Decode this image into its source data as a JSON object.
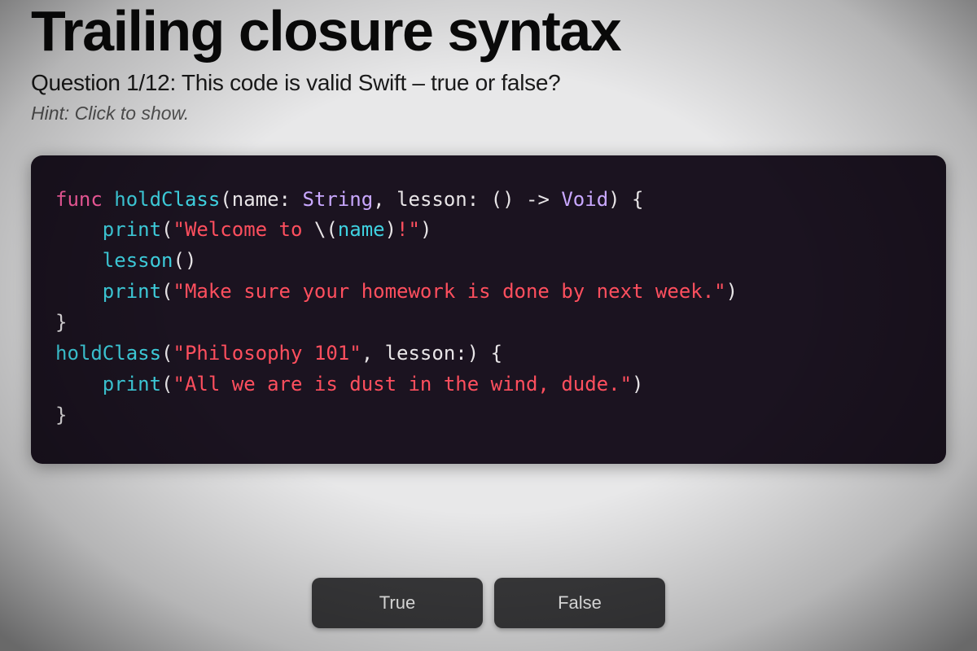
{
  "header": {
    "title": "Trailing closure syntax",
    "question_prefix": "Question 1/12: ",
    "question_body": "This code is valid Swift – true or false?",
    "hint": "Hint: Click to show."
  },
  "code": {
    "tokens": [
      [
        {
          "t": "func ",
          "c": "kw"
        },
        {
          "t": "holdClass",
          "c": "def"
        },
        {
          "t": "(",
          "c": "plain"
        },
        {
          "t": "name",
          "c": "plain"
        },
        {
          "t": ": ",
          "c": "plain"
        },
        {
          "t": "String",
          "c": "type"
        },
        {
          "t": ", ",
          "c": "plain"
        },
        {
          "t": "lesson",
          "c": "plain"
        },
        {
          "t": ": () -> ",
          "c": "plain"
        },
        {
          "t": "Void",
          "c": "type"
        },
        {
          "t": ") {",
          "c": "plain"
        }
      ],
      [
        {
          "t": "    ",
          "c": "plain"
        },
        {
          "t": "print",
          "c": "def"
        },
        {
          "t": "(",
          "c": "plain"
        },
        {
          "t": "\"Welcome to ",
          "c": "str"
        },
        {
          "t": "\\(",
          "c": "plain"
        },
        {
          "t": "name",
          "c": "def"
        },
        {
          "t": ")",
          "c": "plain"
        },
        {
          "t": "!\"",
          "c": "str"
        },
        {
          "t": ")",
          "c": "plain"
        }
      ],
      [
        {
          "t": "    ",
          "c": "plain"
        },
        {
          "t": "lesson",
          "c": "def"
        },
        {
          "t": "()",
          "c": "plain"
        }
      ],
      [
        {
          "t": "    ",
          "c": "plain"
        },
        {
          "t": "print",
          "c": "def"
        },
        {
          "t": "(",
          "c": "plain"
        },
        {
          "t": "\"Make sure your homework is done by next week.\"",
          "c": "str"
        },
        {
          "t": ")",
          "c": "plain"
        }
      ],
      [
        {
          "t": "}",
          "c": "plain"
        }
      ],
      [
        {
          "t": "holdClass",
          "c": "def"
        },
        {
          "t": "(",
          "c": "plain"
        },
        {
          "t": "\"Philosophy 101\"",
          "c": "str"
        },
        {
          "t": ", lesson:) {",
          "c": "plain"
        }
      ],
      [
        {
          "t": "    ",
          "c": "plain"
        },
        {
          "t": "print",
          "c": "def"
        },
        {
          "t": "(",
          "c": "plain"
        },
        {
          "t": "\"All we are is dust in the wind, dude.\"",
          "c": "str"
        },
        {
          "t": ")",
          "c": "plain"
        }
      ],
      [
        {
          "t": "}",
          "c": "plain"
        }
      ]
    ]
  },
  "buttons": {
    "true_label": "True",
    "false_label": "False"
  }
}
